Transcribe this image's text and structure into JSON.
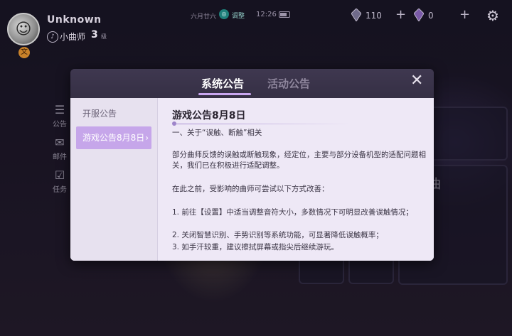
{
  "header": {
    "username": "Unknown",
    "level_badge": "文",
    "rank_label": "小曲师",
    "rank_value": "3",
    "rank_unit": "级",
    "date": "六月廿六",
    "network_label": "调整",
    "time": "12:26",
    "currency_1": "110",
    "currency_2": "0"
  },
  "side_nav": [
    {
      "label": "公告",
      "icon": "megaphone-icon"
    },
    {
      "label": "邮件",
      "icon": "mail-icon"
    },
    {
      "label": "任务",
      "icon": "task-icon"
    }
  ],
  "background": {
    "panel_char": "曲"
  },
  "modal": {
    "tabs": [
      {
        "label": "系统公告",
        "active": true
      },
      {
        "label": "活动公告",
        "active": false
      }
    ],
    "sidebar": [
      {
        "label": "开服公告",
        "active": false
      },
      {
        "label": "游戏公告8月8日",
        "active": true
      }
    ],
    "content": {
      "title": "游戏公告8月8日",
      "line_1": "一、关于“误触、断触”相关",
      "para_1": "部分曲师反馈的误触或断触现象，经定位，主要与部分设备机型的适配问题相关，我们已在积极进行适配调整。",
      "para_2": "在此之前，受影响的曲师可尝试以下方式改善：",
      "item_1": "1. 前往【设置】中适当调整音符大小，多数情况下可明显改善误触情况；",
      "item_2": "2. 关闭智慧识别、手势识别等系统功能，可显著降低误触概率；",
      "item_3": "3. 如手汗较重，建议擦拭屏幕或指尖后继续游玩。"
    }
  },
  "colors": {
    "accent": "#c6a6ea",
    "tab_underline": "#c9a6f0",
    "modal_header": "#3b3448",
    "modal_body": "#eee8f6"
  }
}
